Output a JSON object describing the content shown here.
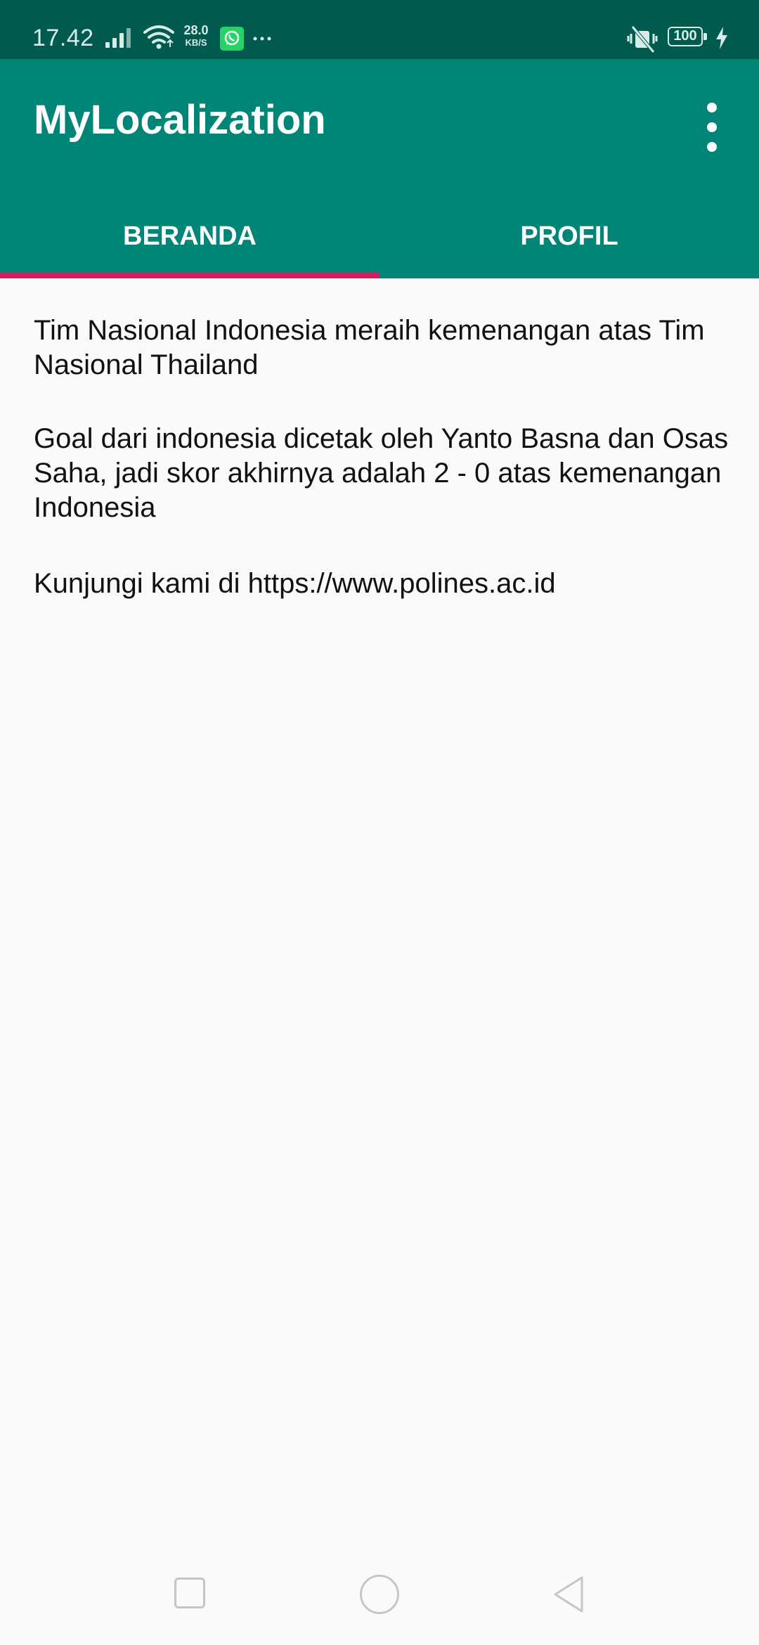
{
  "status_bar": {
    "time": "17.42",
    "network_speed_value": "28.0",
    "network_speed_unit": "KB/S",
    "battery_level": "100",
    "icons": [
      "signal-icon",
      "wifi-icon",
      "whatsapp-icon",
      "more-notifications-icon",
      "vibrate-icon",
      "battery-icon",
      "charging-icon"
    ]
  },
  "app_bar": {
    "title": "MyLocalization",
    "overflow_icon": "more-vert-icon"
  },
  "tabs": [
    {
      "label": "BERANDA",
      "selected": true
    },
    {
      "label": "PROFIL",
      "selected": false
    }
  ],
  "content": {
    "paragraphs": [
      "Tim Nasional Indonesia meraih kemenangan atas Tim Nasional Thailand",
      "Goal dari indonesia dicetak oleh Yanto Basna dan Osas Saha, jadi skor akhirnya adalah 2 - 0 atas kemenangan Indonesia",
      "Kunjungi kami di https://www.polines.ac.id"
    ]
  },
  "nav_bar": {
    "icons": [
      "recents-icon",
      "home-icon",
      "back-icon"
    ]
  },
  "colors": {
    "status_bar": "#005a4e",
    "primary": "#008577",
    "tab_indicator": "#d81b60",
    "background": "#fafafa"
  }
}
